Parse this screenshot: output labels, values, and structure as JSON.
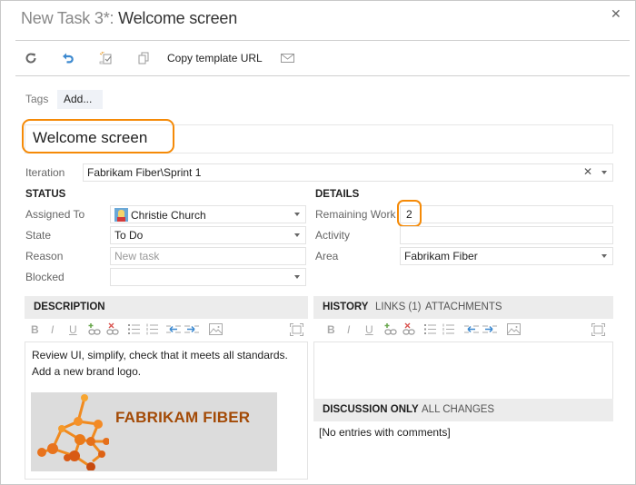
{
  "window": {
    "title_prefix": "New Task 3*:",
    "title_name": " Welcome screen",
    "close_icon": "close-icon"
  },
  "toolbar": {
    "icons": [
      "refresh-icon",
      "undo-icon",
      "save-template-icon",
      "copy-icon",
      "email-icon"
    ],
    "copy_template_url_label": "Copy template URL"
  },
  "tags": {
    "label": "Tags",
    "add_label": "Add..."
  },
  "work_item": {
    "title": "Welcome screen",
    "iteration_label": "Iteration",
    "iteration_value": "Fabrikam Fiber\\Sprint 1"
  },
  "status": {
    "header": "STATUS",
    "assigned_to_label": "Assigned To",
    "assigned_to_value": "Christie Church",
    "state_label": "State",
    "state_value": "To Do",
    "reason_label": "Reason",
    "reason_value": "New task",
    "blocked_label": "Blocked",
    "blocked_value": ""
  },
  "details": {
    "header": "DETAILS",
    "remaining_work_label": "Remaining Work",
    "remaining_work_value": "2",
    "activity_label": "Activity",
    "activity_value": "",
    "area_label": "Area",
    "area_value": "Fabrikam Fiber"
  },
  "description": {
    "header": "DESCRIPTION",
    "text": "Review UI, simplify, check that it meets all standards. Add a new brand logo.",
    "logo_text": "FABRIKAM FIBER"
  },
  "rte_toolbar": {
    "bold": "B",
    "italic": "I",
    "underline": "U"
  },
  "history": {
    "tabs": [
      "HISTORY",
      "LINKS (1)",
      "ATTACHMENTS"
    ],
    "filter_tabs": [
      "DISCUSSION ONLY",
      "ALL CHANGES"
    ],
    "empty_text": "[No entries with comments]"
  },
  "colors": {
    "highlight": "#f58a07",
    "logo_text": "#a34a06",
    "undo_icon": "#3e8ad0"
  }
}
